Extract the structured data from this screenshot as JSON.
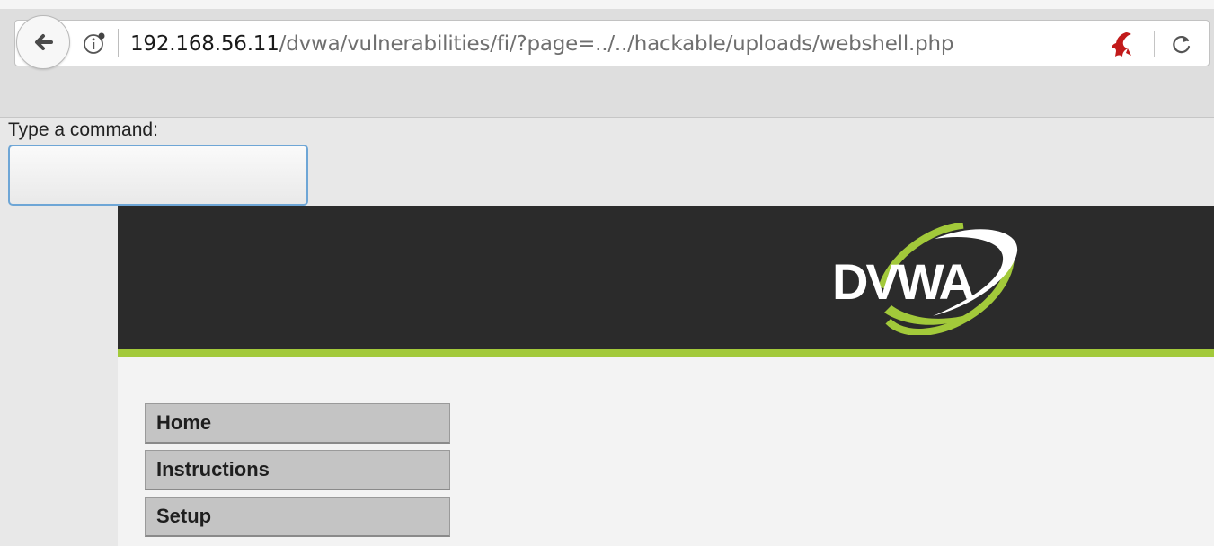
{
  "browser": {
    "url_host": "192.168.56.11",
    "url_path": "/dvwa/vulnerabilities/fi/?page=../../hackable/uploads/webshell.php",
    "icons": {
      "back": "back-arrow-icon",
      "info": "site-info-icon",
      "extension": "extension-icon",
      "reload": "reload-icon"
    }
  },
  "page": {
    "command_label": "Type a command:",
    "command_value": "",
    "command_placeholder": ""
  },
  "dvwa": {
    "logo_text": "DVWA",
    "colors": {
      "header": "#2b2b2b",
      "accent": "#a2c93a"
    },
    "menu": [
      {
        "label": "Home"
      },
      {
        "label": "Instructions"
      },
      {
        "label": "Setup"
      }
    ]
  }
}
